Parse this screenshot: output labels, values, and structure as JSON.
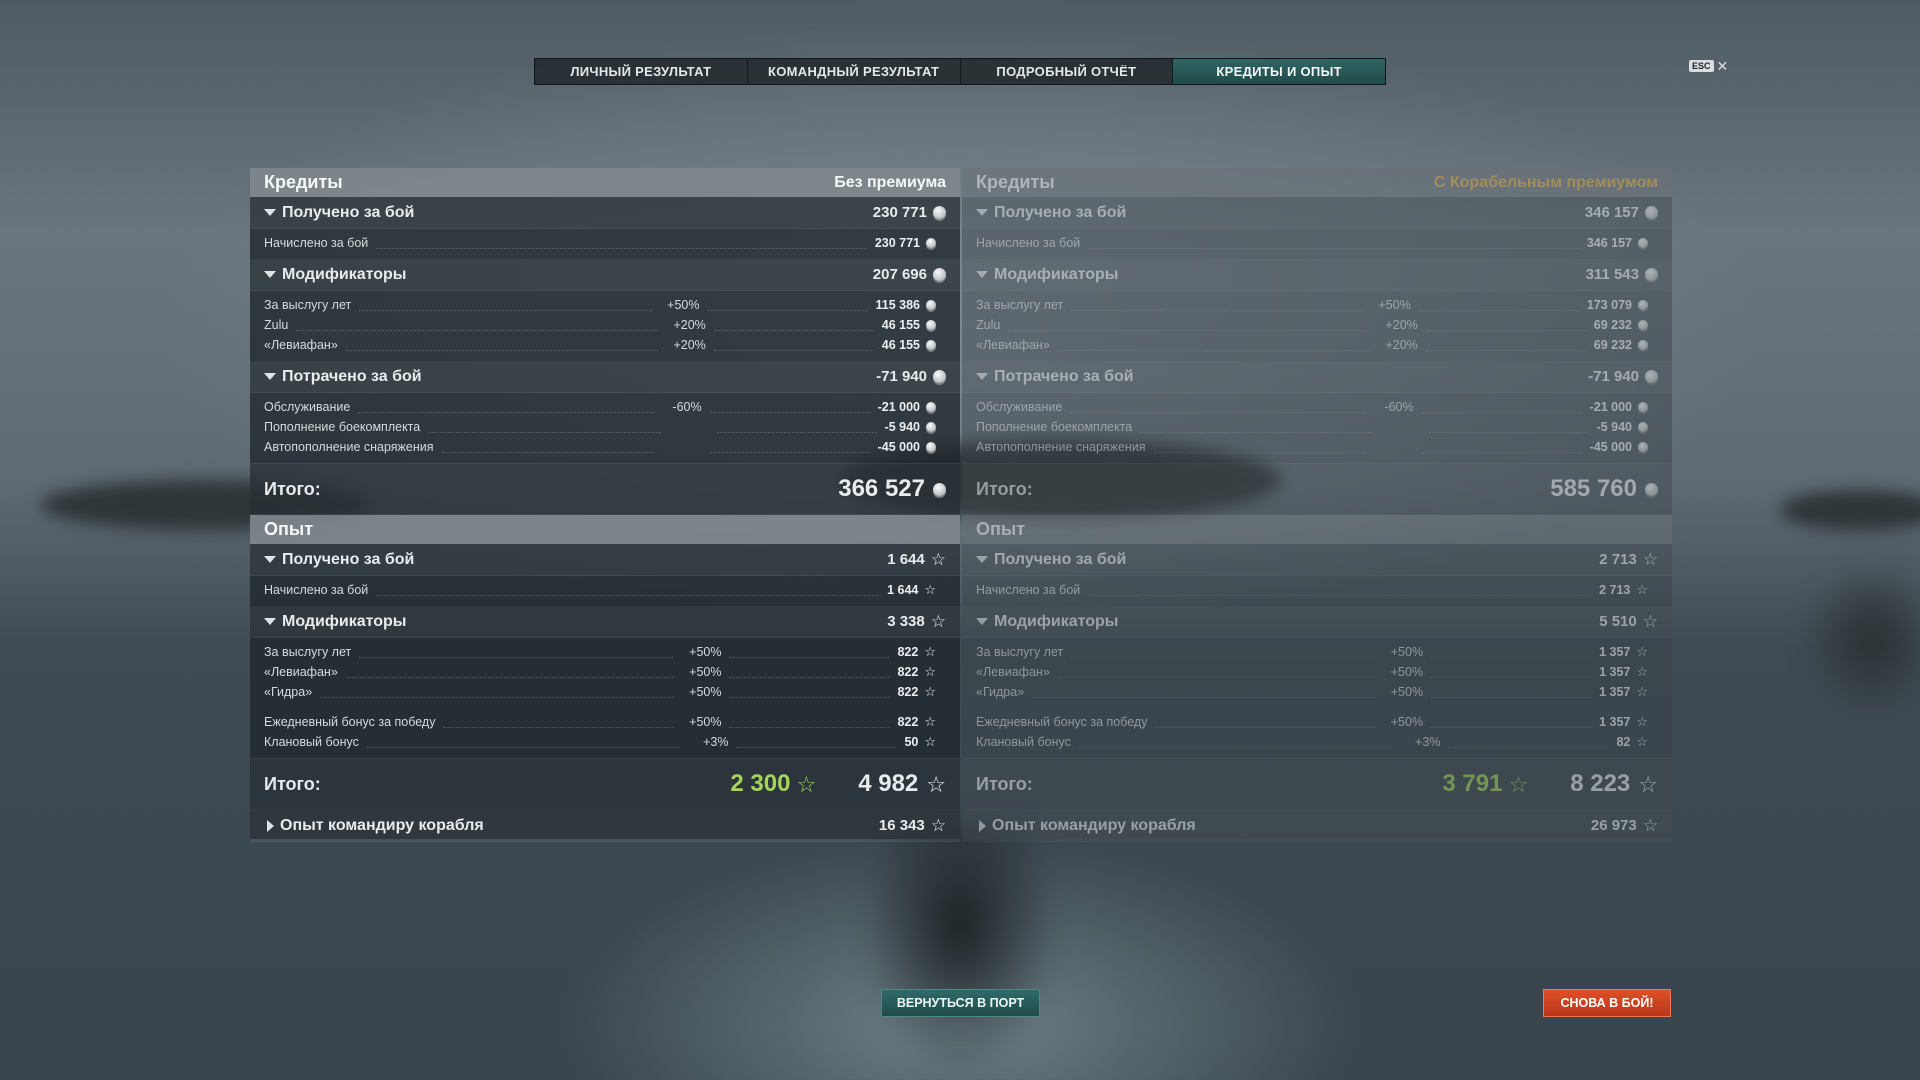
{
  "tabs": [
    {
      "label": "ЛИЧНЫЙ РЕЗУЛЬТАТ"
    },
    {
      "label": "КОМАНДНЫЙ РЕЗУЛЬТАТ"
    },
    {
      "label": "ПОДРОБНЫЙ ОТЧЁТ"
    },
    {
      "label": "КРЕДИТЫ И ОПЫТ"
    }
  ],
  "active_tab": "КРЕДИТЫ И ОПЫТ",
  "esc_label": "ESC",
  "colors": {
    "accent_teal": "#2f6664",
    "premium_gold": "#e6b457",
    "xp_green": "#a6d35a",
    "battle_red": "#d2432a"
  },
  "left": {
    "credits_title": "Кредиты",
    "credits_subtitle": "Без премиума",
    "earned_label": "Получено за бой",
    "earned_value": "230 771",
    "earned_row_label": "Начислено за бой",
    "earned_row_value": "230 771",
    "mods_label": "Модификаторы",
    "mods_value": "207 696",
    "mods": [
      {
        "name": "За выслугу лет",
        "pct": "+50%",
        "value": "115 386"
      },
      {
        "name": "Zulu",
        "pct": "+20%",
        "value": "46 155"
      },
      {
        "name": "«Левиафан»",
        "pct": "+20%",
        "value": "46 155"
      }
    ],
    "spent_label": "Потрачено за бой",
    "spent_value": "-71 940",
    "spent": [
      {
        "name": "Обслуживание",
        "pct": "-60%",
        "value": "-21 000"
      },
      {
        "name": "Пополнение боекомплекта",
        "pct": "",
        "value": "-5 940"
      },
      {
        "name": "Автопополнение снаряжения",
        "pct": "",
        "value": "-45 000"
      }
    ],
    "total_label": "Итого:",
    "credits_total": "366 527",
    "xp_title": "Опыт",
    "xp_earned_label": "Получено за бой",
    "xp_earned_value": "1 644",
    "xp_earned_row_label": "Начислено за бой",
    "xp_earned_row_value": "1 644",
    "xp_mods_label": "Модификаторы",
    "xp_mods_value": "3 338",
    "xp_mods": [
      {
        "name": "За выслугу лет",
        "pct": "+50%",
        "value": "822"
      },
      {
        "name": "«Левиафан»",
        "pct": "+50%",
        "value": "822"
      },
      {
        "name": "«Гидра»",
        "pct": "+50%",
        "value": "822"
      }
    ],
    "xp_bonus": [
      {
        "name": "Ежедневный бонус за победу",
        "pct": "+50%",
        "value": "822"
      },
      {
        "name": "Клановый бонус",
        "pct": "+3%",
        "value": "50"
      }
    ],
    "xp_total_green": "2 300",
    "xp_total": "4 982",
    "commander_label": "Опыт командиру корабля",
    "commander_value": "16 343"
  },
  "right": {
    "credits_title": "Кредиты",
    "credits_subtitle": "С Корабельным премиумом",
    "earned_label": "Получено за бой",
    "earned_value": "346 157",
    "earned_row_label": "Начислено за бой",
    "earned_row_value": "346 157",
    "mods_label": "Модификаторы",
    "mods_value": "311 543",
    "mods": [
      {
        "name": "За выслугу лет",
        "pct": "+50%",
        "value": "173 079"
      },
      {
        "name": "Zulu",
        "pct": "+20%",
        "value": "69 232"
      },
      {
        "name": "«Левиафан»",
        "pct": "+20%",
        "value": "69 232"
      }
    ],
    "spent_label": "Потрачено за бой",
    "spent_value": "-71 940",
    "spent": [
      {
        "name": "Обслуживание",
        "pct": "-60%",
        "value": "-21 000"
      },
      {
        "name": "Пополнение боекомплекта",
        "pct": "",
        "value": "-5 940"
      },
      {
        "name": "Автопополнение снаряжения",
        "pct": "",
        "value": "-45 000"
      }
    ],
    "total_label": "Итого:",
    "credits_total": "585 760",
    "xp_title": "Опыт",
    "xp_earned_label": "Получено за бой",
    "xp_earned_value": "2 713",
    "xp_earned_row_label": "Начислено за бой",
    "xp_earned_row_value": "2 713",
    "xp_mods_label": "Модификаторы",
    "xp_mods_value": "5 510",
    "xp_mods": [
      {
        "name": "За выслугу лет",
        "pct": "+50%",
        "value": "1 357"
      },
      {
        "name": "«Левиафан»",
        "pct": "+50%",
        "value": "1 357"
      },
      {
        "name": "«Гидра»",
        "pct": "+50%",
        "value": "1 357"
      }
    ],
    "xp_bonus": [
      {
        "name": "Ежедневный бонус за победу",
        "pct": "+50%",
        "value": "1 357"
      },
      {
        "name": "Клановый бонус",
        "pct": "+3%",
        "value": "82"
      }
    ],
    "xp_total_green": "3 791",
    "xp_total": "8 223",
    "commander_label": "Опыт командиру корабля",
    "commander_value": "26 973"
  },
  "buttons": {
    "port": "ВЕРНУТЬСЯ В ПОРТ",
    "battle": "СНОВА В БОЙ!"
  }
}
